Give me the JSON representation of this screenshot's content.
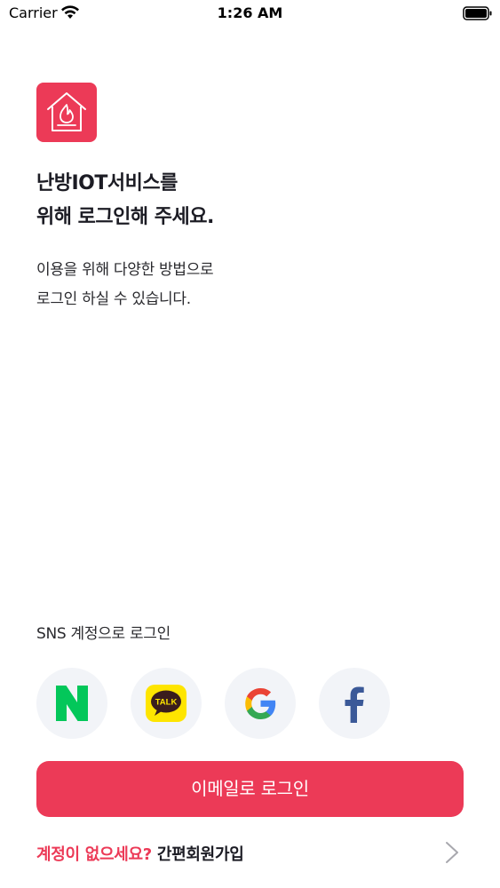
{
  "status_bar": {
    "carrier": "Carrier",
    "time": "1:26 AM"
  },
  "headline": {
    "line1": "난방IOT서비스를",
    "line2": "위해 로그인해 주세요."
  },
  "subtext": {
    "line1": "이용을 위해 다양한 방법으로",
    "line2": "로그인 하실 수 있습니다."
  },
  "sns": {
    "label": "SNS 계정으로 로그인",
    "providers": [
      {
        "id": "naver",
        "icon": "naver-icon"
      },
      {
        "id": "kakao",
        "icon": "kakao-talk-icon",
        "badge_text": "TALK"
      },
      {
        "id": "google",
        "icon": "google-icon"
      },
      {
        "id": "facebook",
        "icon": "facebook-icon"
      }
    ]
  },
  "email_login": {
    "label": "이메일로 로그인"
  },
  "signup": {
    "question": "계정이 없으세요?",
    "link": "간편회원가입"
  },
  "colors": {
    "accent": "#ec3a57",
    "sns_bg": "#f2f4f8",
    "naver": "#03c75a",
    "kakao": "#fee500",
    "facebook": "#3b5998"
  }
}
